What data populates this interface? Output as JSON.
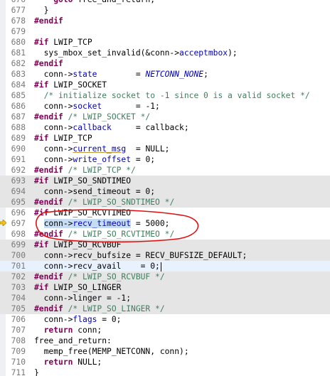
{
  "colors": {
    "directive": "#7f0055",
    "field": "#0000c0",
    "comment": "#3f7f5f",
    "disabled_bg": "#e5e5e5",
    "current_line_bg": "#e8f2fe",
    "annotation_red": "#e01010"
  },
  "icons": {
    "debug_arrow": "current-instruction-arrow-icon"
  },
  "lines": [
    {
      "n": "676",
      "t": [
        {
          "s": "    ",
          "c": ""
        },
        {
          "s": "goto",
          "c": "kw"
        },
        {
          "s": " free_and_return;",
          "c": ""
        }
      ]
    },
    {
      "n": "677",
      "t": [
        {
          "s": "  }",
          "c": ""
        }
      ]
    },
    {
      "n": "678",
      "t": [
        {
          "s": "#endif",
          "c": "dir"
        }
      ]
    },
    {
      "n": "679",
      "t": []
    },
    {
      "n": "680",
      "t": [
        {
          "s": "#if",
          "c": "dir"
        },
        {
          "s": " LWIP_TCP",
          "c": ""
        }
      ]
    },
    {
      "n": "681",
      "t": [
        {
          "s": "  sys_mbox_set_invalid(&conn->",
          "c": ""
        },
        {
          "s": "acceptmbox",
          "c": "fld"
        },
        {
          "s": ");",
          "c": ""
        }
      ]
    },
    {
      "n": "682",
      "t": [
        {
          "s": "#endif",
          "c": "dir"
        }
      ]
    },
    {
      "n": "683",
      "t": [
        {
          "s": "  conn->",
          "c": ""
        },
        {
          "s": "state",
          "c": "fld"
        },
        {
          "s": "        = ",
          "c": ""
        },
        {
          "s": "NETCONN_NONE",
          "c": "cst"
        },
        {
          "s": ";",
          "c": ""
        }
      ]
    },
    {
      "n": "684",
      "t": [
        {
          "s": "#if",
          "c": "dir"
        },
        {
          "s": " LWIP_SOCKET",
          "c": ""
        }
      ]
    },
    {
      "n": "685",
      "t": [
        {
          "s": "  /* initialize socket to -1 since 0 is a valid socket */",
          "c": "cmt"
        }
      ]
    },
    {
      "n": "686",
      "t": [
        {
          "s": "  conn->",
          "c": ""
        },
        {
          "s": "socket",
          "c": "fld"
        },
        {
          "s": "       = -1;",
          "c": ""
        }
      ]
    },
    {
      "n": "687",
      "t": [
        {
          "s": "#endif",
          "c": "dir"
        },
        {
          "s": " /* LWIP_SOCKET */",
          "c": "cmt"
        }
      ]
    },
    {
      "n": "688",
      "t": [
        {
          "s": "  conn->",
          "c": ""
        },
        {
          "s": "callback",
          "c": "fld"
        },
        {
          "s": "     = callback;",
          "c": ""
        }
      ]
    },
    {
      "n": "689",
      "t": [
        {
          "s": "#if",
          "c": "dir"
        },
        {
          "s": " LWIP_TCP",
          "c": ""
        }
      ]
    },
    {
      "n": "690",
      "t": [
        {
          "s": "  conn->",
          "c": ""
        },
        {
          "s": "current_msg",
          "c": "fld und"
        },
        {
          "s": "  = NULL;",
          "c": ""
        }
      ]
    },
    {
      "n": "691",
      "t": [
        {
          "s": "  conn->",
          "c": ""
        },
        {
          "s": "write_offset",
          "c": "fld"
        },
        {
          "s": " = 0;",
          "c": ""
        }
      ]
    },
    {
      "n": "692",
      "t": [
        {
          "s": "#endif",
          "c": "dir"
        },
        {
          "s": " /* LWIP_TCP */",
          "c": "cmt"
        }
      ]
    },
    {
      "n": "693",
      "dis": true,
      "t": [
        {
          "s": "#if",
          "c": "dir"
        },
        {
          "s": " LWIP_SO_SNDTIMEO",
          "c": ""
        }
      ]
    },
    {
      "n": "694",
      "dis": true,
      "t": [
        {
          "s": "  conn->send_timeout = 0;",
          "c": ""
        }
      ]
    },
    {
      "n": "695",
      "dis": true,
      "t": [
        {
          "s": "#endif",
          "c": "dir"
        },
        {
          "s": " /* LWIP_SO_SNDTIMEO */",
          "c": "cmt"
        }
      ]
    },
    {
      "n": "696",
      "t": [
        {
          "s": "#if",
          "c": "dir"
        },
        {
          "s": " LWIP_SO_RCVTIMEO",
          "c": ""
        }
      ]
    },
    {
      "n": "697",
      "t": [
        {
          "s": "  ",
          "c": ""
        },
        {
          "s": "conn->",
          "c": "sel"
        },
        {
          "s": "recv_timeout",
          "c": "fld sel"
        },
        {
          "s": " = 5000;",
          "c": ""
        }
      ]
    },
    {
      "n": "698",
      "t": [
        {
          "s": "#endif",
          "c": "dir"
        },
        {
          "s": " /* LWIP_SO_RCVTIMEO */",
          "c": "cmt"
        }
      ]
    },
    {
      "n": "699",
      "dis": true,
      "t": [
        {
          "s": "#if",
          "c": "dir"
        },
        {
          "s": " LWIP_SO_RCVBUF",
          "c": ""
        }
      ]
    },
    {
      "n": "700",
      "dis": true,
      "t": [
        {
          "s": "  conn->recv_bufsize = RECV_BUFSIZE_DEFAULT;",
          "c": ""
        }
      ]
    },
    {
      "n": "701",
      "cur": true,
      "caret": true,
      "t": [
        {
          "s": "  conn->recv_avail    = 0;",
          "c": ""
        }
      ]
    },
    {
      "n": "702",
      "dis": true,
      "t": [
        {
          "s": "#endif",
          "c": "dir"
        },
        {
          "s": " /* LWIP_SO_RCVBUF */",
          "c": "cmt"
        }
      ]
    },
    {
      "n": "703",
      "dis": true,
      "t": [
        {
          "s": "#if",
          "c": "dir"
        },
        {
          "s": " LWIP_SO_LINGER",
          "c": ""
        }
      ]
    },
    {
      "n": "704",
      "dis": true,
      "t": [
        {
          "s": "  conn->linger = -1;",
          "c": ""
        }
      ]
    },
    {
      "n": "705",
      "dis": true,
      "t": [
        {
          "s": "#endif",
          "c": "dir"
        },
        {
          "s": " /* LWIP_SO_LINGER */",
          "c": "cmt"
        }
      ]
    },
    {
      "n": "706",
      "t": [
        {
          "s": "  conn->",
          "c": ""
        },
        {
          "s": "flags",
          "c": "fld"
        },
        {
          "s": " = 0;",
          "c": ""
        }
      ]
    },
    {
      "n": "707",
      "t": [
        {
          "s": "  ",
          "c": ""
        },
        {
          "s": "return",
          "c": "kw"
        },
        {
          "s": " conn;",
          "c": ""
        }
      ]
    },
    {
      "n": "708",
      "t": [
        {
          "s": "free_and_return:",
          "c": ""
        }
      ]
    },
    {
      "n": "709",
      "t": [
        {
          "s": "  memp_free(MEMP_NETCONN, conn);",
          "c": ""
        }
      ]
    },
    {
      "n": "710",
      "t": [
        {
          "s": "  ",
          "c": ""
        },
        {
          "s": "return",
          "c": "kw"
        },
        {
          "s": " NULL;",
          "c": ""
        }
      ]
    },
    {
      "n": "711",
      "t": [
        {
          "s": "}",
          "c": ""
        }
      ]
    }
  ]
}
